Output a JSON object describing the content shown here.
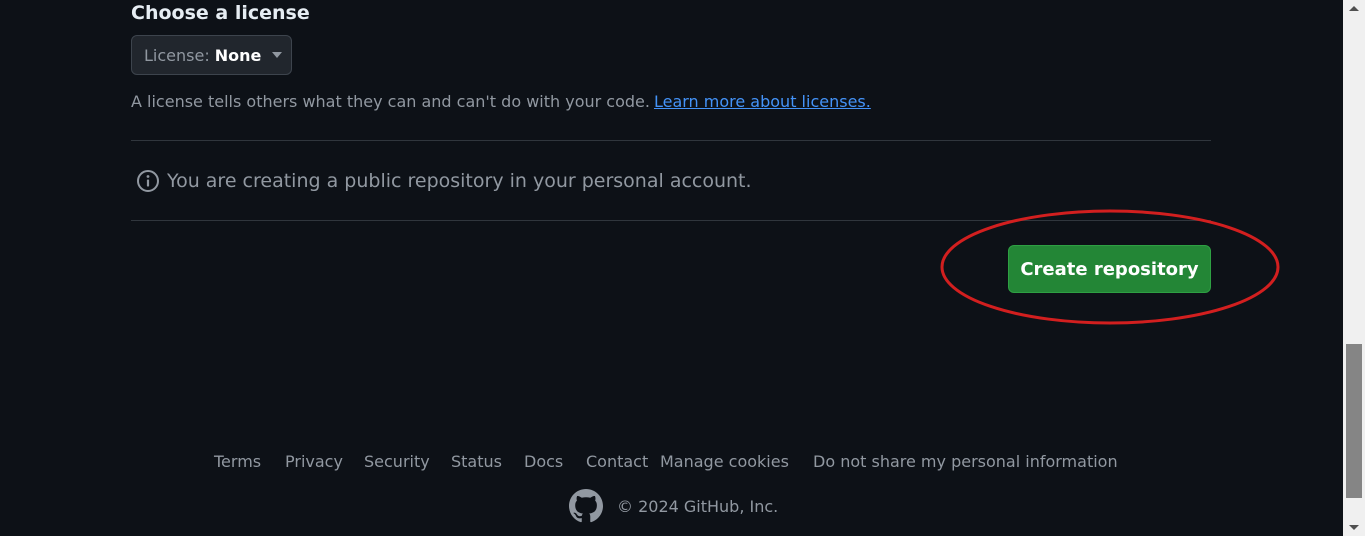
{
  "license": {
    "heading": "Choose a license",
    "select_label": "License:",
    "select_value": "None",
    "help_text": "A license tells others what they can and can't do with your code.",
    "help_link": "Learn more about licenses."
  },
  "notice": {
    "text": "You are creating a public repository in your personal account."
  },
  "actions": {
    "create_label": "Create repository"
  },
  "footer": {
    "links": [
      "Terms",
      "Privacy",
      "Security",
      "Status",
      "Docs",
      "Contact",
      "Manage cookies",
      "Do not share my personal information"
    ],
    "copyright": "© 2024 GitHub, Inc."
  },
  "colors": {
    "background": "#0d1117",
    "button_green": "#238636",
    "link_blue": "#4493f8",
    "annotation_red": "#d21f1f"
  }
}
